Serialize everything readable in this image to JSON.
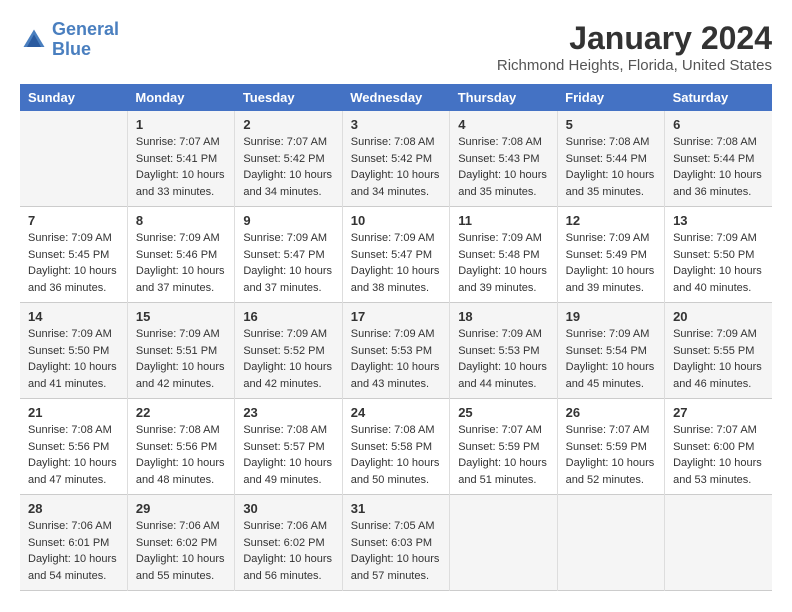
{
  "logo": {
    "line1": "General",
    "line2": "Blue"
  },
  "title": "January 2024",
  "subtitle": "Richmond Heights, Florida, United States",
  "headers": [
    "Sunday",
    "Monday",
    "Tuesday",
    "Wednesday",
    "Thursday",
    "Friday",
    "Saturday"
  ],
  "weeks": [
    [
      {
        "day": "",
        "sunrise": "",
        "sunset": "",
        "daylight": ""
      },
      {
        "day": "1",
        "sunrise": "Sunrise: 7:07 AM",
        "sunset": "Sunset: 5:41 PM",
        "daylight": "Daylight: 10 hours and 33 minutes."
      },
      {
        "day": "2",
        "sunrise": "Sunrise: 7:07 AM",
        "sunset": "Sunset: 5:42 PM",
        "daylight": "Daylight: 10 hours and 34 minutes."
      },
      {
        "day": "3",
        "sunrise": "Sunrise: 7:08 AM",
        "sunset": "Sunset: 5:42 PM",
        "daylight": "Daylight: 10 hours and 34 minutes."
      },
      {
        "day": "4",
        "sunrise": "Sunrise: 7:08 AM",
        "sunset": "Sunset: 5:43 PM",
        "daylight": "Daylight: 10 hours and 35 minutes."
      },
      {
        "day": "5",
        "sunrise": "Sunrise: 7:08 AM",
        "sunset": "Sunset: 5:44 PM",
        "daylight": "Daylight: 10 hours and 35 minutes."
      },
      {
        "day": "6",
        "sunrise": "Sunrise: 7:08 AM",
        "sunset": "Sunset: 5:44 PM",
        "daylight": "Daylight: 10 hours and 36 minutes."
      }
    ],
    [
      {
        "day": "7",
        "sunrise": "Sunrise: 7:09 AM",
        "sunset": "Sunset: 5:45 PM",
        "daylight": "Daylight: 10 hours and 36 minutes."
      },
      {
        "day": "8",
        "sunrise": "Sunrise: 7:09 AM",
        "sunset": "Sunset: 5:46 PM",
        "daylight": "Daylight: 10 hours and 37 minutes."
      },
      {
        "day": "9",
        "sunrise": "Sunrise: 7:09 AM",
        "sunset": "Sunset: 5:47 PM",
        "daylight": "Daylight: 10 hours and 37 minutes."
      },
      {
        "day": "10",
        "sunrise": "Sunrise: 7:09 AM",
        "sunset": "Sunset: 5:47 PM",
        "daylight": "Daylight: 10 hours and 38 minutes."
      },
      {
        "day": "11",
        "sunrise": "Sunrise: 7:09 AM",
        "sunset": "Sunset: 5:48 PM",
        "daylight": "Daylight: 10 hours and 39 minutes."
      },
      {
        "day": "12",
        "sunrise": "Sunrise: 7:09 AM",
        "sunset": "Sunset: 5:49 PM",
        "daylight": "Daylight: 10 hours and 39 minutes."
      },
      {
        "day": "13",
        "sunrise": "Sunrise: 7:09 AM",
        "sunset": "Sunset: 5:50 PM",
        "daylight": "Daylight: 10 hours and 40 minutes."
      }
    ],
    [
      {
        "day": "14",
        "sunrise": "Sunrise: 7:09 AM",
        "sunset": "Sunset: 5:50 PM",
        "daylight": "Daylight: 10 hours and 41 minutes."
      },
      {
        "day": "15",
        "sunrise": "Sunrise: 7:09 AM",
        "sunset": "Sunset: 5:51 PM",
        "daylight": "Daylight: 10 hours and 42 minutes."
      },
      {
        "day": "16",
        "sunrise": "Sunrise: 7:09 AM",
        "sunset": "Sunset: 5:52 PM",
        "daylight": "Daylight: 10 hours and 42 minutes."
      },
      {
        "day": "17",
        "sunrise": "Sunrise: 7:09 AM",
        "sunset": "Sunset: 5:53 PM",
        "daylight": "Daylight: 10 hours and 43 minutes."
      },
      {
        "day": "18",
        "sunrise": "Sunrise: 7:09 AM",
        "sunset": "Sunset: 5:53 PM",
        "daylight": "Daylight: 10 hours and 44 minutes."
      },
      {
        "day": "19",
        "sunrise": "Sunrise: 7:09 AM",
        "sunset": "Sunset: 5:54 PM",
        "daylight": "Daylight: 10 hours and 45 minutes."
      },
      {
        "day": "20",
        "sunrise": "Sunrise: 7:09 AM",
        "sunset": "Sunset: 5:55 PM",
        "daylight": "Daylight: 10 hours and 46 minutes."
      }
    ],
    [
      {
        "day": "21",
        "sunrise": "Sunrise: 7:08 AM",
        "sunset": "Sunset: 5:56 PM",
        "daylight": "Daylight: 10 hours and 47 minutes."
      },
      {
        "day": "22",
        "sunrise": "Sunrise: 7:08 AM",
        "sunset": "Sunset: 5:56 PM",
        "daylight": "Daylight: 10 hours and 48 minutes."
      },
      {
        "day": "23",
        "sunrise": "Sunrise: 7:08 AM",
        "sunset": "Sunset: 5:57 PM",
        "daylight": "Daylight: 10 hours and 49 minutes."
      },
      {
        "day": "24",
        "sunrise": "Sunrise: 7:08 AM",
        "sunset": "Sunset: 5:58 PM",
        "daylight": "Daylight: 10 hours and 50 minutes."
      },
      {
        "day": "25",
        "sunrise": "Sunrise: 7:07 AM",
        "sunset": "Sunset: 5:59 PM",
        "daylight": "Daylight: 10 hours and 51 minutes."
      },
      {
        "day": "26",
        "sunrise": "Sunrise: 7:07 AM",
        "sunset": "Sunset: 5:59 PM",
        "daylight": "Daylight: 10 hours and 52 minutes."
      },
      {
        "day": "27",
        "sunrise": "Sunrise: 7:07 AM",
        "sunset": "Sunset: 6:00 PM",
        "daylight": "Daylight: 10 hours and 53 minutes."
      }
    ],
    [
      {
        "day": "28",
        "sunrise": "Sunrise: 7:06 AM",
        "sunset": "Sunset: 6:01 PM",
        "daylight": "Daylight: 10 hours and 54 minutes."
      },
      {
        "day": "29",
        "sunrise": "Sunrise: 7:06 AM",
        "sunset": "Sunset: 6:02 PM",
        "daylight": "Daylight: 10 hours and 55 minutes."
      },
      {
        "day": "30",
        "sunrise": "Sunrise: 7:06 AM",
        "sunset": "Sunset: 6:02 PM",
        "daylight": "Daylight: 10 hours and 56 minutes."
      },
      {
        "day": "31",
        "sunrise": "Sunrise: 7:05 AM",
        "sunset": "Sunset: 6:03 PM",
        "daylight": "Daylight: 10 hours and 57 minutes."
      },
      {
        "day": "",
        "sunrise": "",
        "sunset": "",
        "daylight": ""
      },
      {
        "day": "",
        "sunrise": "",
        "sunset": "",
        "daylight": ""
      },
      {
        "day": "",
        "sunrise": "",
        "sunset": "",
        "daylight": ""
      }
    ]
  ]
}
